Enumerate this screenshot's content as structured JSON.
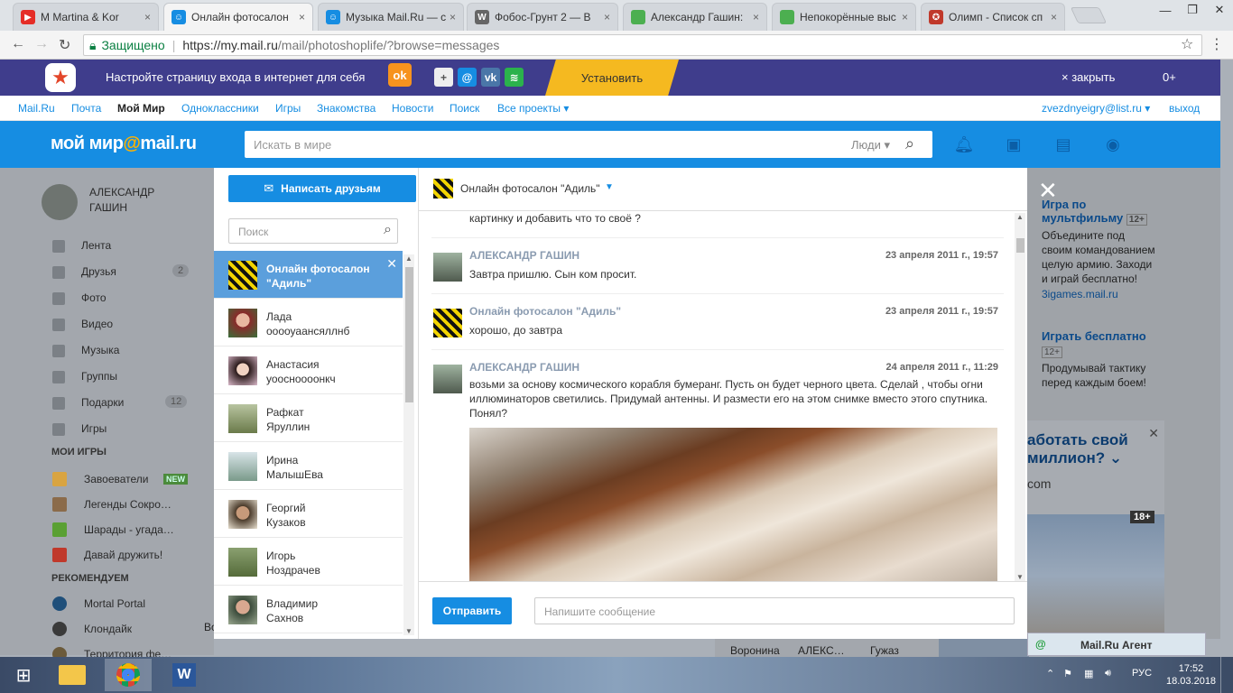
{
  "browser": {
    "tabs": [
      {
        "title": "M Martina & Kor",
        "icon": "youtube-icon",
        "color": "#e52d27",
        "glyph": "▶"
      },
      {
        "title": "Онлайн фотосалон",
        "icon": "mailru-icon",
        "color": "#168de2",
        "glyph": "☺"
      },
      {
        "title": "Музыка Mail.Ru — с",
        "icon": "mailru-icon",
        "color": "#168de2",
        "glyph": "☺"
      },
      {
        "title": "Фобос-Грунт 2 — В",
        "icon": "wikipedia-icon",
        "color": "#666666",
        "glyph": "W"
      },
      {
        "title": "Александр Гашин: ",
        "icon": "page-icon",
        "color": "#4caf50",
        "glyph": ""
      },
      {
        "title": "Непокорённые выс",
        "icon": "page-icon",
        "color": "#4caf50",
        "glyph": ""
      },
      {
        "title": "Олимп - Список сп",
        "icon": "olymp-icon",
        "color": "#c0392b",
        "glyph": "✪"
      }
    ],
    "secure_label": "Защищено",
    "url_host": "https://my.mail.ru",
    "url_path": "/mail/photoshoplife/?browse=messages"
  },
  "promo": {
    "text": "Настройте страницу входа в интернет для себя",
    "install": "Установить",
    "close": "закрыть",
    "counter": "0+"
  },
  "portal_nav": {
    "items": [
      "Mail.Ru",
      "Почта",
      "Мой Мир",
      "Одноклассники",
      "Игры",
      "Знакомства",
      "Новости",
      "Поиск",
      "Все проекты ▾"
    ],
    "user": "zvezdnyeigry@list.ru ▾",
    "logout": "выход"
  },
  "header": {
    "logo_main": "мой мир",
    "logo_at": "@",
    "logo_tail": "mail.ru",
    "search_placeholder": "Искать в мире",
    "search_scope": "Люди ▾"
  },
  "sidebar": {
    "user_name_1": "АЛЕКСАНДР",
    "user_name_2": "ГАШИН",
    "menu": [
      {
        "label": "Лента"
      },
      {
        "label": "Друзья",
        "badge": "2"
      },
      {
        "label": "Фото"
      },
      {
        "label": "Видео"
      },
      {
        "label": "Музыка"
      },
      {
        "label": "Группы"
      },
      {
        "label": "Подарки",
        "badge": "12"
      },
      {
        "label": "Игры"
      }
    ],
    "games_header": "МОИ ИГРЫ",
    "games": [
      {
        "label": "Завоеватели",
        "tag": "NEW"
      },
      {
        "label": "Легенды Сокро…"
      },
      {
        "label": "Шарады - угада…"
      },
      {
        "label": "Давай дружить!"
      }
    ],
    "rec_header": "РЕКОМЕНДУЕМ",
    "recommended": [
      "Mortal Portal",
      "Клондайк",
      "Территория фе…"
    ]
  },
  "messages_modal": {
    "write_button": "Написать друзьям",
    "search_placeholder": "Поиск",
    "contacts": [
      {
        "line1": "Онлайн фотосалон",
        "line2": "\"Адиль\"",
        "active": true
      },
      {
        "line1": "Лада",
        "line2": "ооооуаансяллнб"
      },
      {
        "line1": "Анастасия",
        "line2": "уоосноооонкч"
      },
      {
        "line1": "Рафкат",
        "line2": "Яруллин"
      },
      {
        "line1": "Ирина",
        "line2": "МалышЕва"
      },
      {
        "line1": "Георгий",
        "line2": "Кузаков"
      },
      {
        "line1": "Игорь",
        "line2": "Ноздрачев"
      },
      {
        "line1": "Владимир",
        "line2": "Сахнов"
      }
    ],
    "conversation_title": "Онлайн фотосалон \"Адиль\"",
    "messages": [
      {
        "author": "",
        "date": "",
        "text": "картинку и добавить что то своё ?"
      },
      {
        "author": "АЛЕКСАНДР ГАШИН",
        "date": "23 апреля 2011 г., 19:57",
        "text": "Завтра пришлю. Сын ком просит."
      },
      {
        "author": "Онлайн фотосалон \"Адиль\"",
        "date": "23 апреля 2011 г., 19:57",
        "text": "хорошо, до завтра"
      },
      {
        "author": "АЛЕКСАНДР ГАШИН",
        "date": "24 апреля 2011 г., 11:29",
        "text": "возьми за основу космического корабля бумеранг. Пусть он будет черного цвета. Сделай , чтобы огни иллюминаторов светились. Придумай антенны. И размести его на этом снимке вместо этого спутника. Понял?"
      }
    ],
    "send_button": "Отправить",
    "message_placeholder": "Напишите сообщение"
  },
  "right_panel": {
    "ad1_title_1": "Игра по",
    "ad1_title_2": "мультфильму",
    "ad1_age": "12+",
    "ad1_text": [
      "Объедините под",
      "своим командованием",
      "целую армию. Заходи",
      "и играй бесплатно!"
    ],
    "ad1_link": "3igames.mail.ru",
    "ad2_title": "Играть бесплатно",
    "ad2_age": "12+",
    "ad2_text": [
      "Продумывай тактику",
      "перед каждым боем!"
    ],
    "ad3_title_1": "аботать свой",
    "ad3_title_2": "миллион?",
    "ad3_link": "com",
    "ad3_age": "18+"
  },
  "bottom_row": {
    "c1": "Воронина",
    "c2": "АЛЕКС…",
    "c3": "Гужаз",
    "left_stub": "Во"
  },
  "agent": {
    "label": "Mail.Ru Агент"
  },
  "taskbar": {
    "lang": "РУС",
    "time": "17:52",
    "date": "18.03.2018"
  }
}
